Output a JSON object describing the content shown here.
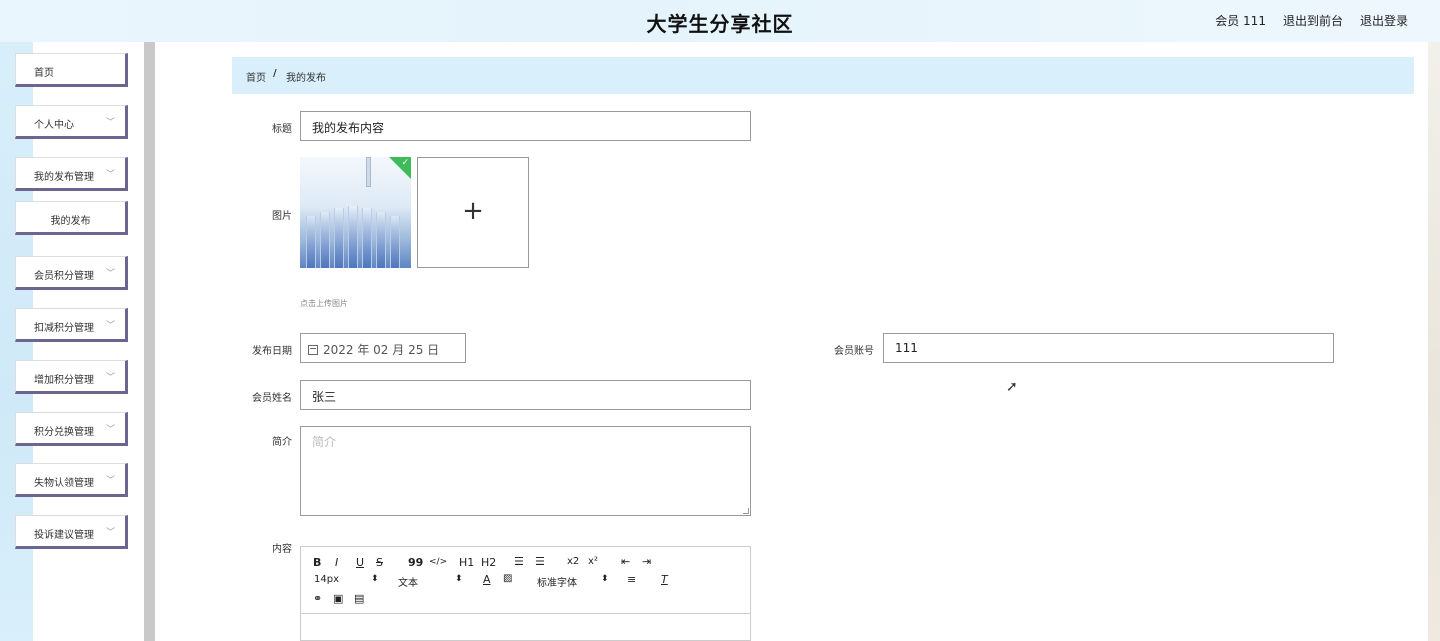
{
  "header": {
    "site_title": "大学生分享社区",
    "member": "会员 111",
    "to_front": "退出到前台",
    "logout": "退出登录"
  },
  "sidebar": {
    "items": [
      {
        "label": "首页",
        "has_chevron": false
      },
      {
        "label": "个人中心",
        "has_chevron": true
      },
      {
        "label": "我的发布管理",
        "has_chevron": true
      },
      {
        "label": "我的发布",
        "has_chevron": false,
        "sub": true
      },
      {
        "label": "会员积分管理",
        "has_chevron": true
      },
      {
        "label": "扣减积分管理",
        "has_chevron": true
      },
      {
        "label": "增加积分管理",
        "has_chevron": true
      },
      {
        "label": "积分兑换管理",
        "has_chevron": true
      },
      {
        "label": "失物认领管理",
        "has_chevron": true
      },
      {
        "label": "投诉建议管理",
        "has_chevron": true
      }
    ]
  },
  "breadcrumb": {
    "home": "首页",
    "separator": "/",
    "current": "我的发布"
  },
  "form": {
    "title_label": "标题",
    "title_value": "我的发布内容",
    "image_label": "图片",
    "upload_plus": "+",
    "upload_hint": "点击上传图片",
    "date_label": "发布日期",
    "date_value": "2022 年 02 月 25 日",
    "account_label": "会员账号",
    "account_value": "111",
    "name_label": "会员姓名",
    "name_value": "张三",
    "intro_label": "简介",
    "intro_placeholder": "简介",
    "content_label": "内容"
  },
  "editor": {
    "row1": [
      "B",
      "I",
      "U",
      "S",
      "99",
      "</>",
      "H1",
      "H2",
      "ol",
      "ul",
      "x2",
      "x²",
      "outdent",
      "indent"
    ],
    "font_size": "14px",
    "text_style": "文本",
    "font_family": "标准字体",
    "row3": [
      "link",
      "image",
      "video"
    ]
  }
}
